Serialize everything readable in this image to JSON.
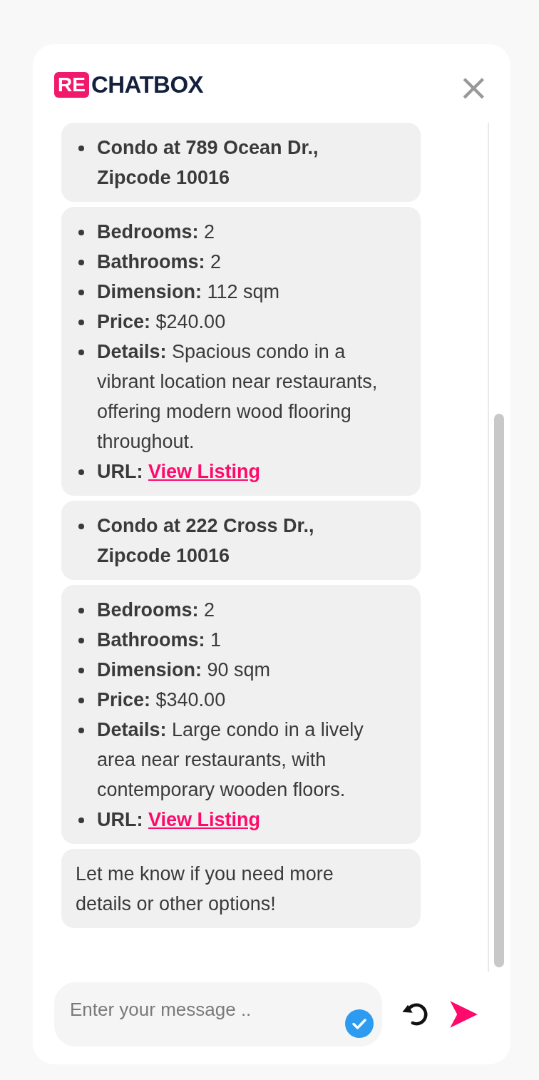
{
  "header": {
    "logo": {
      "mark": "RE",
      "name": "CHATBOX"
    },
    "close": "×"
  },
  "messages": [
    {
      "kind": "list",
      "items": [
        {
          "kind": "heading",
          "text": "Condo at 789 Ocean Dr., Zipcode 10016"
        }
      ]
    },
    {
      "kind": "list",
      "items": [
        {
          "kind": "field",
          "text": "**Bedrooms:** 2"
        },
        {
          "kind": "field",
          "text": "**Bathrooms:** 2"
        },
        {
          "kind": "field",
          "text": "**Dimension:** 112 sqm"
        },
        {
          "kind": "field",
          "text": "**Price:** $240.00"
        },
        {
          "kind": "field",
          "text": "**Details:** Spacious condo in a vibrant location near restaurants, offering modern wood flooring throughout."
        },
        {
          "kind": "field",
          "text": "**URL:**",
          "link": "View Listing"
        }
      ]
    },
    {
      "kind": "list",
      "items": [
        {
          "kind": "heading",
          "text": "Condo at 222 Cross Dr., Zipcode 10016"
        }
      ]
    },
    {
      "kind": "list",
      "items": [
        {
          "kind": "field",
          "text": "**Bedrooms:** 2"
        },
        {
          "kind": "field",
          "text": "**Bathrooms:** 1"
        },
        {
          "kind": "field",
          "text": "**Dimension:** 90 sqm"
        },
        {
          "kind": "field",
          "text": "**Price:** $340.00"
        },
        {
          "kind": "field",
          "text": "**Details:** Large condo in a lively area near restaurants, with contemporary wooden floors."
        },
        {
          "kind": "field",
          "text": "**URL:**",
          "link": "View Listing"
        }
      ]
    },
    {
      "kind": "text",
      "text": "Let me know if you need more details or other options!"
    }
  ],
  "composer": {
    "placeholder": "Enter your message .."
  }
}
